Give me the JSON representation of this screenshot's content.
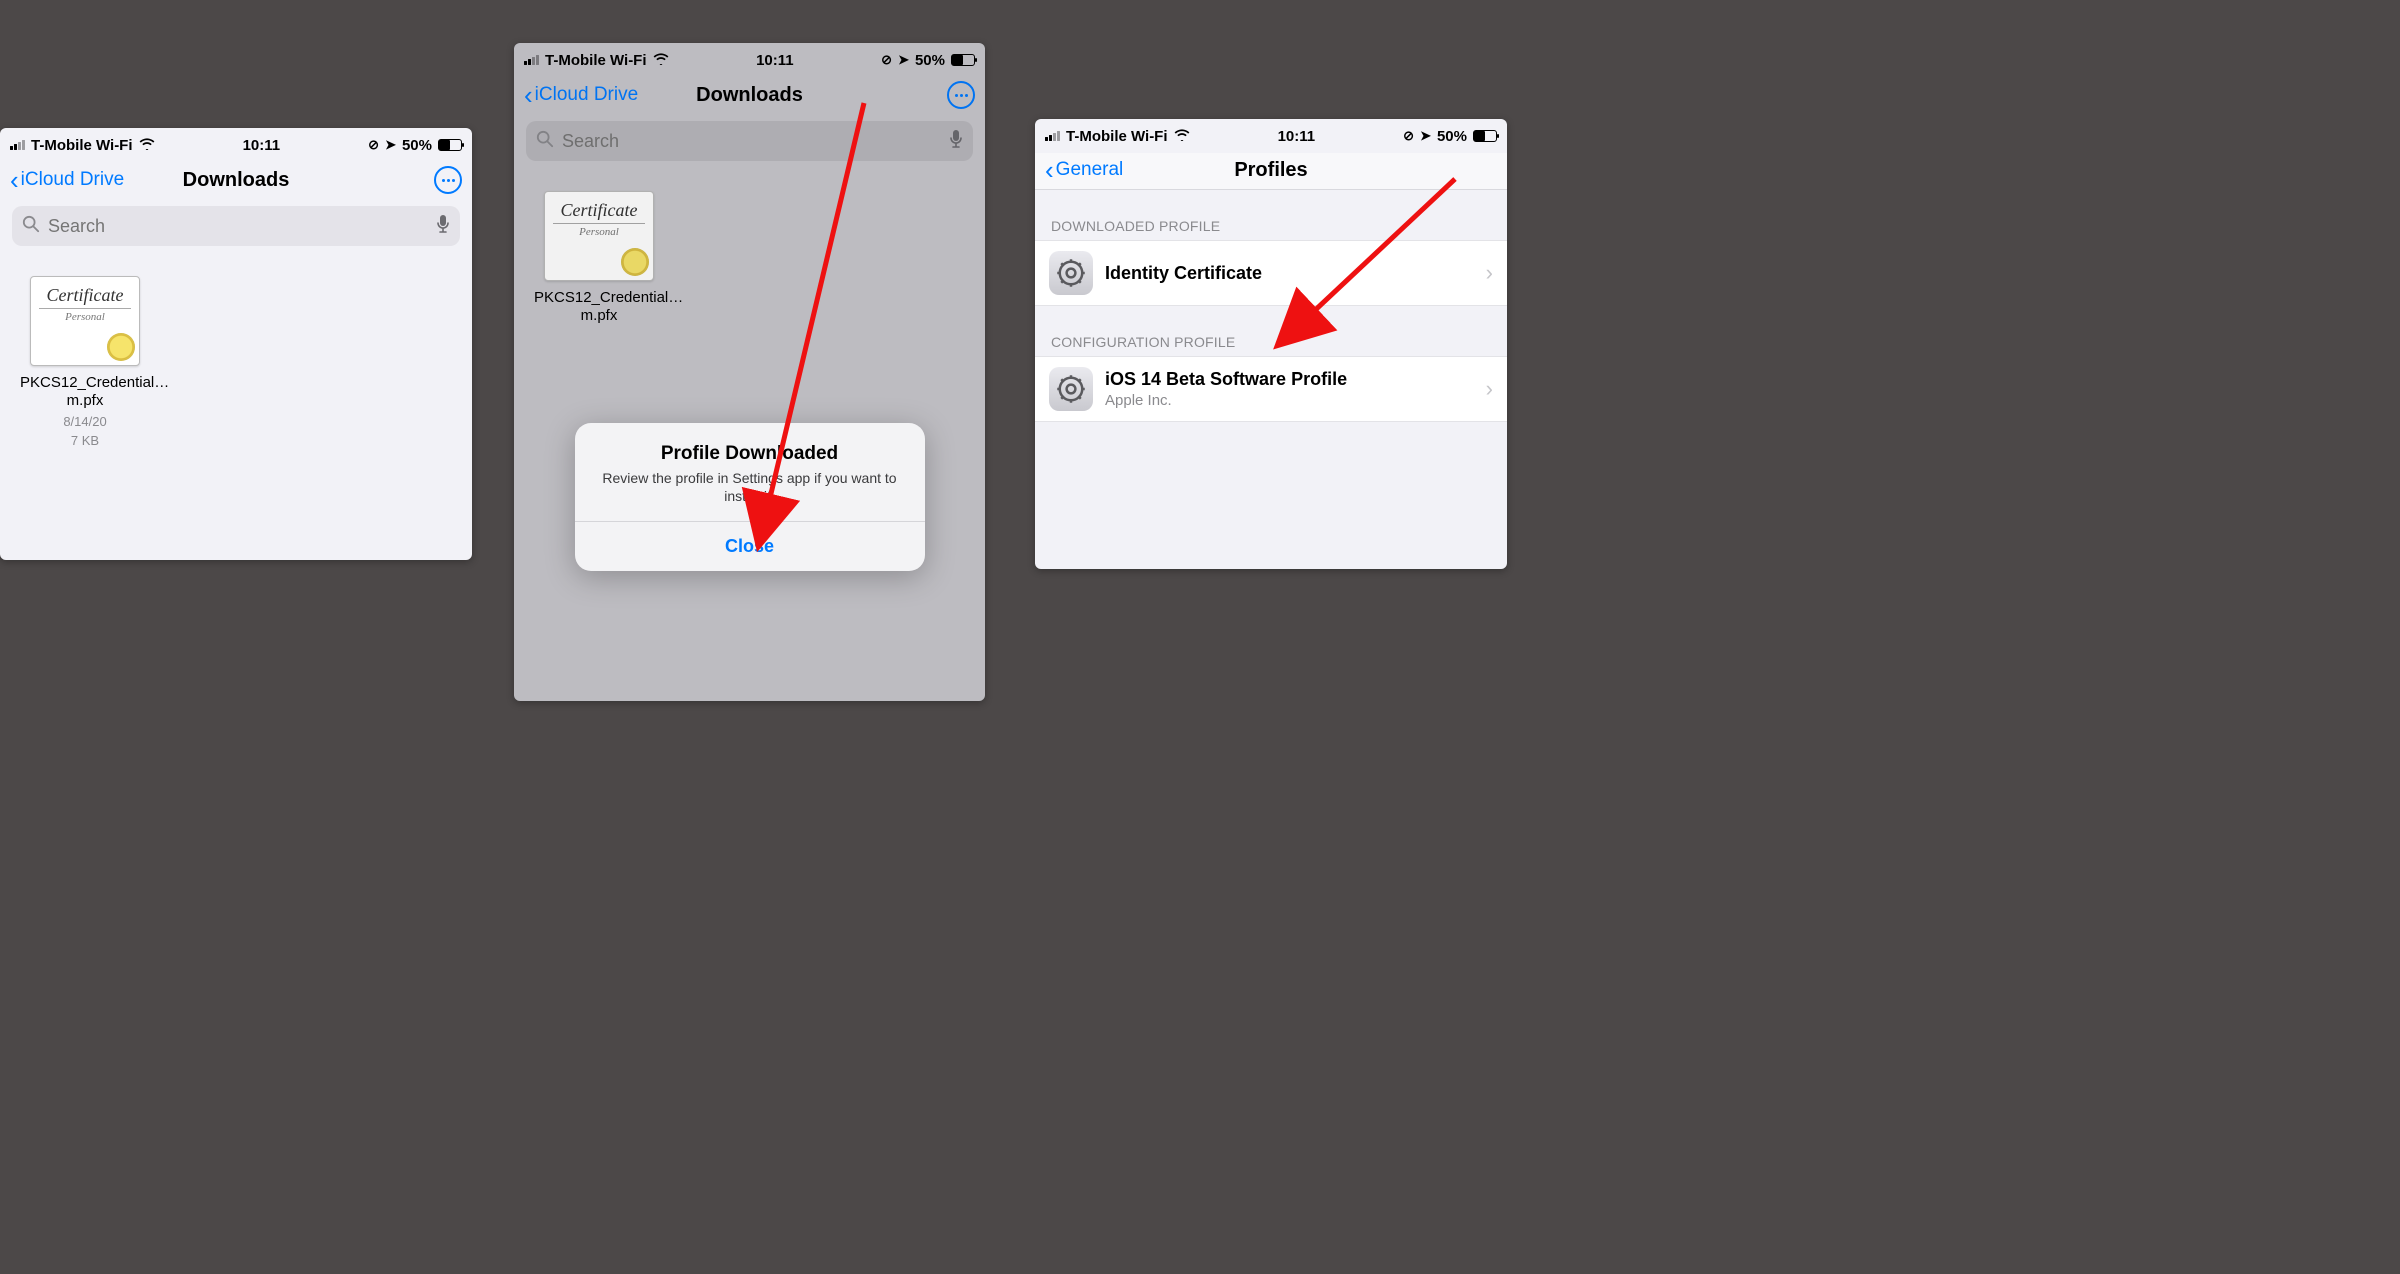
{
  "status": {
    "carrier": "T-Mobile Wi-Fi",
    "time": "10:11",
    "battery": "50%"
  },
  "phone1": {
    "back": "iCloud Drive",
    "title": "Downloads",
    "search_placeholder": "Search",
    "file": {
      "name": "PKCS12_Credential…m.pfx",
      "date": "8/14/20",
      "size": "7 KB",
      "cert_title": "Certificate",
      "cert_sub": "Personal"
    }
  },
  "phone2": {
    "back": "iCloud Drive",
    "title": "Downloads",
    "search_placeholder": "Search",
    "file": {
      "name": "PKCS12_Credential…m.pfx",
      "cert_title": "Certificate",
      "cert_sub": "Personal"
    },
    "alert": {
      "title": "Profile Downloaded",
      "msg": "Review the profile in Settings app if you want to install it.",
      "button": "Close"
    }
  },
  "phone3": {
    "back": "General",
    "title": "Profiles",
    "section1": "DOWNLOADED PROFILE",
    "row1": {
      "title": "Identity Certificate"
    },
    "section2": "CONFIGURATION PROFILE",
    "row2": {
      "title": "iOS 14 Beta Software Profile",
      "sub": "Apple Inc."
    }
  }
}
